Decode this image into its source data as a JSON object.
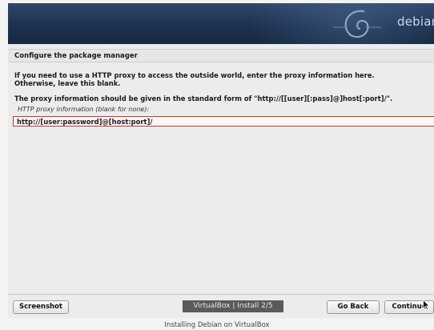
{
  "banner": {
    "brand": "debian"
  },
  "section_title": "Configure the package manager",
  "intro_text": {
    "line1": "If you need to use a HTTP proxy to access the outside world, enter the proxy information here.",
    "line2": "Otherwise, leave this blank."
  },
  "format_text": "The proxy information should be given in the standard form of \"http://[[user][:pass]@]host[:port]/\".",
  "field": {
    "label": "HTTP proxy information (blank for none):",
    "value": "http://[user:password]@[host:port]/"
  },
  "buttons": {
    "screenshot": "Screenshot",
    "go_back": "Go Back",
    "continue": "Continue"
  },
  "vbox_label": "VirtualBox | Install 2/5",
  "caption": "Installing Debian on VirtualBox",
  "colors": {
    "banner": "#1d3150",
    "field_border": "#c0392b"
  }
}
